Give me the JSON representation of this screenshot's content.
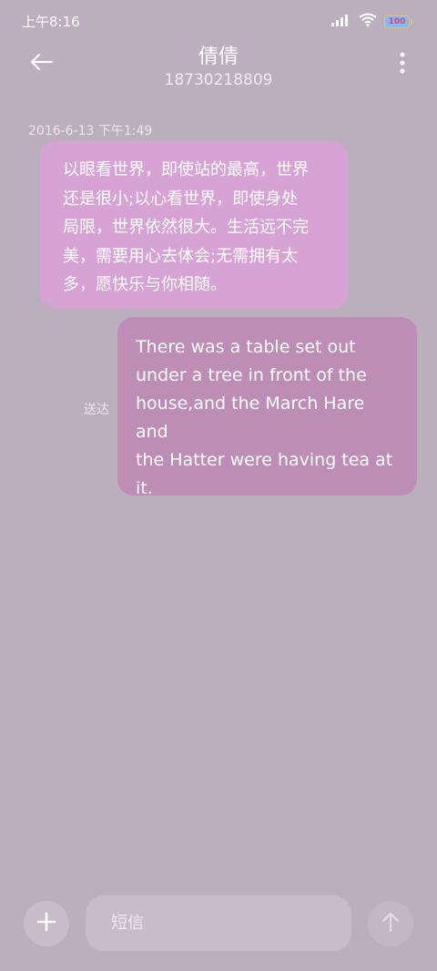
{
  "status_bar": {
    "time": "上午8:16",
    "battery_level": "100",
    "signal_icon": "signal-bars-icon",
    "wifi_icon": "wifi-icon",
    "battery_icon": "battery-icon"
  },
  "header": {
    "contact_name": "倩倩",
    "phone_number": "18730218809",
    "back_icon": "arrow-left-icon",
    "more_icon": "more-vertical-icon"
  },
  "conversation": {
    "timestamp": "2016-6-13 下午1:49",
    "messages": [
      {
        "direction": "received",
        "lines": [
          "以眼看世界，即使站的最高，世界",
          "还是很小;以心看世界，即使身处",
          "局限，世界依然很大。生活远不完",
          "美，需要用心去体会;无需拥有太",
          "多，愿快乐与你相随。"
        ]
      },
      {
        "direction": "sent",
        "lines": [
          "There was a table set out",
          "under a tree in front of the",
          "house,and the March Hare and",
          "the Hatter were having tea at",
          "it."
        ],
        "status": "送达"
      }
    ]
  },
  "composer": {
    "placeholder": "短信",
    "value": "",
    "add_icon": "plus-icon",
    "send_icon": "arrow-up-icon"
  },
  "colors": {
    "background": "#bbaebd",
    "received_bubble": "#d7a2d4",
    "sent_bubble": "#bd8db6"
  }
}
